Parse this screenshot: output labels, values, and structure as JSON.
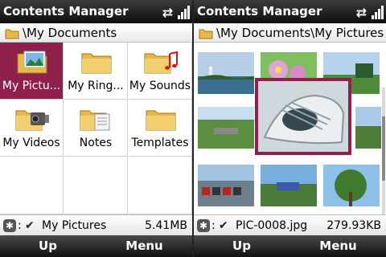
{
  "left": {
    "title": "Contents Manager",
    "path": "\\My Documents",
    "items": [
      {
        "label": "My Pictu...",
        "icon": "pictures-folder-icon"
      },
      {
        "label": "My Ring...",
        "icon": "folder-icon"
      },
      {
        "label": "My Sounds",
        "icon": "music-folder-icon"
      },
      {
        "label": "My Videos",
        "icon": "video-folder-icon"
      },
      {
        "label": "Notes",
        "icon": "notes-folder-icon"
      },
      {
        "label": "Templates",
        "icon": "folder-icon"
      }
    ],
    "status": {
      "name": "My Pictures",
      "size": "5.41MB"
    },
    "softkeys": {
      "left": "Up",
      "right": "Menu"
    }
  },
  "right": {
    "title": "Contents Manager",
    "path": "\\My Documents\\My Pictures",
    "status": {
      "name": "PIC-0008.jpg",
      "size": "279.93KB"
    },
    "softkeys": {
      "left": "Up",
      "right": "Menu"
    }
  },
  "colors": {
    "selection": "#8f1f4b",
    "titlebar": "#1a1a1a",
    "folder": "#e8b94a"
  }
}
